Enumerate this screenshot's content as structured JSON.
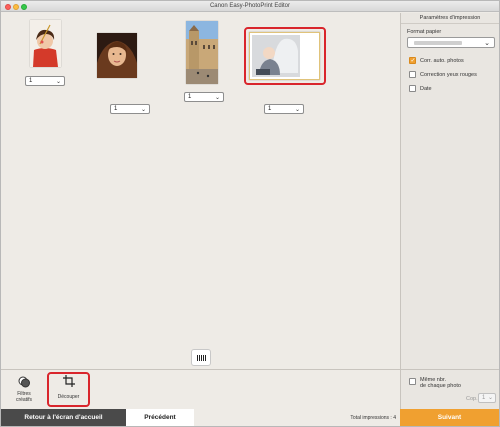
{
  "window": {
    "title": "Canon Easy-PhotoPrint Editor"
  },
  "thumbnails": [
    {
      "qty": "1",
      "alt": "girl-with-paintbrush"
    },
    {
      "qty": "1",
      "alt": "woman-portrait"
    },
    {
      "qty": "1",
      "alt": "town-square"
    },
    {
      "qty": "1",
      "alt": "baby-photo"
    }
  ],
  "sidebar": {
    "header": "Paramètres d'impression",
    "paper_label": "Format papier",
    "options": [
      {
        "label": "Corr. auto. photos",
        "checked": true
      },
      {
        "label": "Correction yeux rouges",
        "checked": false
      },
      {
        "label": "Date",
        "checked": false
      }
    ],
    "same_qty_label_1": "Même nbr.",
    "same_qty_label_2": "de chaque photo",
    "copies_label": "Cop.",
    "copies_value": "1"
  },
  "toolbar": {
    "filters_line1": "Filtres",
    "filters_line2": "créatifs",
    "crop_label": "Découper"
  },
  "bottom": {
    "home_label": "Retour à l'écran d'accueil",
    "prev_label": "Précédent",
    "total_label": "Total impressions : 4",
    "next_label": "Suivant"
  },
  "colors": {
    "accent": "#f0a030",
    "selection": "#d9252c"
  }
}
